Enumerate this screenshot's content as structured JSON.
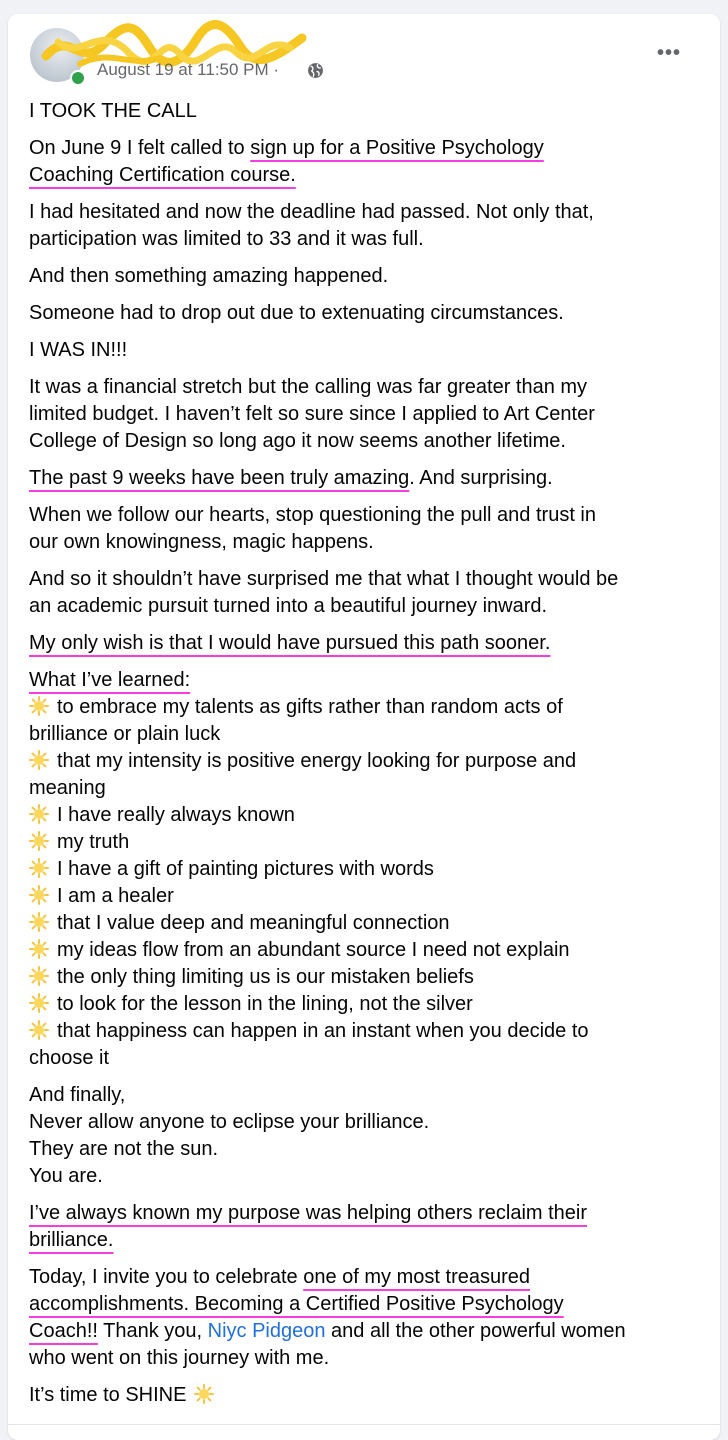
{
  "post": {
    "timestamp": "August 19 at 11:50 PM ·",
    "more_label": "•••",
    "status_color": "#31a24c",
    "highlight_color": "#f53de0",
    "mention_color": "#216fdb"
  },
  "content": {
    "p1": "I TOOK THE CALL",
    "p2": {
      "l1_a": "On June 9 I felt called to ",
      "l1_b": "sign up for a Positive Psychology ",
      "l2": "Coaching Certification course."
    },
    "p3": {
      "l1": "I had hesitated and now the deadline had passed. Not only that,",
      "l2": "participation was limited to 33 and it was full."
    },
    "p4": "And then something amazing happened.",
    "p5": "Someone had to drop out due to extenuating circumstances.",
    "p6": "I WAS IN!!!",
    "p7": {
      "l1": "It was a financial stretch but the calling was far greater than my",
      "l2": "limited budget. I haven’t felt so sure since I applied to Art Center",
      "l3": "College of Design so long ago it now seems another lifetime."
    },
    "p8": {
      "a": "The past 9 weeks have been truly amazing",
      "b": ". And surprising."
    },
    "p9": {
      "l1": "When we follow our hearts, stop questioning the pull and trust in",
      "l2": "our own knowingness, magic happens."
    },
    "p10": {
      "l1": "And so it shouldn’t have surprised me that what I thought would be",
      "l2": "an academic pursuit turned into a beautiful journey inward."
    },
    "p11": "My only wish is that I would have pursued this path sooner.",
    "learned_heading": "What I’ve learned:",
    "learned": [
      {
        "l1": "to embrace my talents as gifts rather than random acts of",
        "l2": "brilliance or plain luck"
      },
      {
        "l1": "that my intensity is positive energy looking for purpose and",
        "l2": "meaning"
      },
      {
        "l1": "I have really always known"
      },
      {
        "l1": "my truth"
      },
      {
        "l1": "I have a gift of painting pictures with words"
      },
      {
        "l1": "I am a healer"
      },
      {
        "l1": "that I value deep and meaningful connection"
      },
      {
        "l1": "my ideas flow from an abundant source I need not explain"
      },
      {
        "l1": "the only thing limiting us is our mistaken beliefs"
      },
      {
        "l1": "to look for the lesson in the lining, not the silver"
      },
      {
        "l1": "that happiness can happen in an instant when you decide to",
        "l2": "choose it"
      }
    ],
    "finally": {
      "l1": "And finally,",
      "l2": "Never allow anyone to eclipse your brilliance.",
      "l3": "They are not the sun.",
      "l4": "You are."
    },
    "purpose": {
      "l1": "I’ve always known my purpose was helping others reclaim their",
      "l2": "brilliance."
    },
    "today": {
      "l1_a": "Today, I invite you to celebrate ",
      "l1_b": "one of my most treasured",
      "l2": "accomplishments. Becoming a Certified Positive Psychology",
      "l3_a": "Coach!!",
      "l3_b": " Thank you, ",
      "l3_mention": "Niyc Pidgeon",
      "l3_c": " and all the other powerful women",
      "l4": "who went on this journey with me."
    },
    "closing": "It’s time to SHINE"
  }
}
